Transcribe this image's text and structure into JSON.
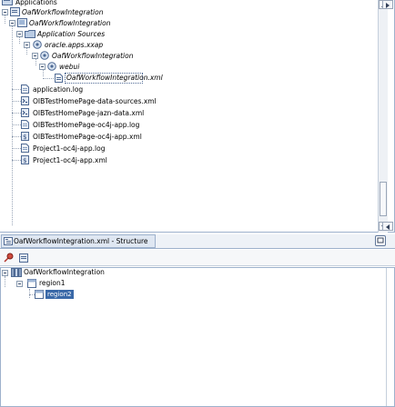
{
  "top_tree": {
    "nodes": [
      {
        "label": "Applications",
        "icon": "application-folder-icon",
        "expanded": null
      },
      {
        "label": "OafWorkflowIntegration",
        "icon": "workspace-icon",
        "expanded": true
      },
      {
        "label": "OafWorkflowIntegration",
        "icon": "project-icon",
        "expanded": true
      },
      {
        "label": "Application Sources",
        "icon": "folder-icon",
        "expanded": true
      },
      {
        "label": "oracle.apps.xxap",
        "icon": "package-icon",
        "expanded": true
      },
      {
        "label": "OafWorkflowIntegration",
        "icon": "package-icon",
        "expanded": true
      },
      {
        "label": "webui",
        "icon": "package-icon",
        "expanded": true
      },
      {
        "label": "OafWorkflowIntegration.xml",
        "icon": "xml-file-icon",
        "selected": true
      },
      {
        "label": "application.log",
        "icon": "log-file-icon"
      },
      {
        "label": "OIBTestHomePage-data-sources.xml",
        "icon": "xml-config-icon"
      },
      {
        "label": "OIBTestHomePage-jazn-data.xml",
        "icon": "xml-config-icon"
      },
      {
        "label": "OIBTestHomePage-oc4j-app.log",
        "icon": "log-file-icon"
      },
      {
        "label": "OIBTestHomePage-oc4j-app.xml",
        "icon": "xml-bin-icon"
      },
      {
        "label": "Project1-oc4j-app.log",
        "icon": "log-file-icon"
      },
      {
        "label": "Project1-oc4j-app.xml",
        "icon": "xml-bin-icon"
      }
    ]
  },
  "structure_tab": {
    "label": "OafWorkflowIntegration.xml - Structure"
  },
  "structure_tree": {
    "nodes": [
      {
        "label": "OafWorkflowIntegration",
        "icon": "page-layout-icon"
      },
      {
        "label": "region1",
        "icon": "region-icon"
      },
      {
        "label": "region2",
        "icon": "region-icon",
        "selected": true
      }
    ]
  },
  "colors": {
    "selection": "#3a69a8",
    "pane_border": "#9db1cc",
    "tab_background": "#dfe7f2"
  }
}
